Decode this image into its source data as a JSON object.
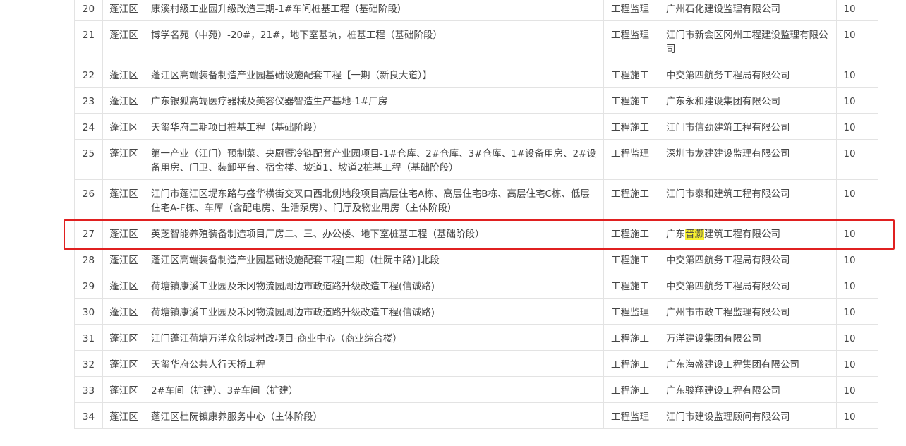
{
  "table": {
    "rows": [
      {
        "idx": "20",
        "district": "蓬江区",
        "project": "康溪村级工业园升级改造三期-1#车间桩基工程（基础阶段）",
        "type": "工程监理",
        "company": "广州石化建设监理有限公司",
        "score": "10"
      },
      {
        "idx": "21",
        "district": "蓬江区",
        "project": "博学名苑（中苑）-20#，21#，地下室基坑，桩基工程（基础阶段）",
        "type": "工程监理",
        "company": "江门市新会区冈州工程建设监理有限公司",
        "score": "10"
      },
      {
        "idx": "22",
        "district": "蓬江区",
        "project": "蓬江区高端装备制造产业园基础设施配套工程【一期（新良大道）】",
        "type": "工程施工",
        "company": "中交第四航务工程局有限公司",
        "score": "10"
      },
      {
        "idx": "23",
        "district": "蓬江区",
        "project": "广东银狐高端医疗器械及美容仪器智造生产基地-1#厂房",
        "type": "工程施工",
        "company": "广东永和建设集团有限公司",
        "score": "10"
      },
      {
        "idx": "24",
        "district": "蓬江区",
        "project": "天玺华府二期项目桩基工程（基础阶段）",
        "type": "工程施工",
        "company": "江门市信劲建筑工程有限公司",
        "score": "10"
      },
      {
        "idx": "25",
        "district": "蓬江区",
        "project": "第一产业（江门）预制菜、央厨暨冷链配套产业园项目-1#仓库、2#仓库、3#仓库、1#设备用房、2#设备用房、门卫、装卸平台、宿舍楼、坡道1、坡道2桩基工程（基础阶段）",
        "type": "工程监理",
        "company": "深圳市龙建建设监理有限公司",
        "score": "10"
      },
      {
        "idx": "26",
        "district": "蓬江区",
        "project": "江门市蓬江区堤东路与盛华横街交叉口西北侧地段项目高层住宅A栋、高层住宅B栋、高层住宅C栋、低层住宅A-F栋、车库（含配电房、生活泵房）、门厅及物业用房（主体阶段）",
        "type": "工程施工",
        "company": "江门市泰和建筑工程有限公司",
        "score": "10"
      },
      {
        "idx": "27",
        "district": "蓬江区",
        "project": "英芝智能养殖装备制造项目厂房二、三、办公楼、地下室桩基工程（基础阶段）",
        "type": "工程施工",
        "company_pre": "广东",
        "company_hl": "晋灏",
        "company_post": "建筑工程有限公司",
        "score": "10"
      },
      {
        "idx": "28",
        "district": "蓬江区",
        "project": "蓬江区高端装备制造产业园基础设施配套工程[二期（杜阮中路）]北段",
        "type": "工程施工",
        "company": "中交第四航务工程局有限公司",
        "score": "10"
      },
      {
        "idx": "29",
        "district": "蓬江区",
        "project": "荷塘镇康溪工业园及禾冈物流园周边市政道路升级改造工程(信诚路)",
        "type": "工程施工",
        "company": "中交第四航务工程局有限公司",
        "score": "10"
      },
      {
        "idx": "30",
        "district": "蓬江区",
        "project": "荷塘镇康溪工业园及禾冈物流园周边市政道路升级改造工程(信诚路)",
        "type": "工程监理",
        "company": "广州市市政工程监理有限公司",
        "score": "10"
      },
      {
        "idx": "31",
        "district": "蓬江区",
        "project": "江门蓬江荷塘万洋众创城村改项目-商业中心（商业综合楼）",
        "type": "工程施工",
        "company": "万洋建设集团有限公司",
        "score": "10"
      },
      {
        "idx": "32",
        "district": "蓬江区",
        "project": "天玺华府公共人行天桥工程",
        "type": "工程施工",
        "company": "广东海盛建设工程集团有限公司",
        "score": "10"
      },
      {
        "idx": "33",
        "district": "蓬江区",
        "project": "2#车间（扩建）、3#车间（扩建）",
        "type": "工程施工",
        "company": "广东骏翔建设工程有限公司",
        "score": "10"
      },
      {
        "idx": "34",
        "district": "蓬江区",
        "project": "蓬江区杜阮镇康养服务中心（主体阶段）",
        "type": "工程监理",
        "company": "江门市建设监理顾问有限公司",
        "score": "10"
      }
    ]
  },
  "colors": {
    "highlight_box": "#e02020",
    "text_highlight": "#f6ef30",
    "border": "#e3e3e3",
    "text": "#444444"
  }
}
